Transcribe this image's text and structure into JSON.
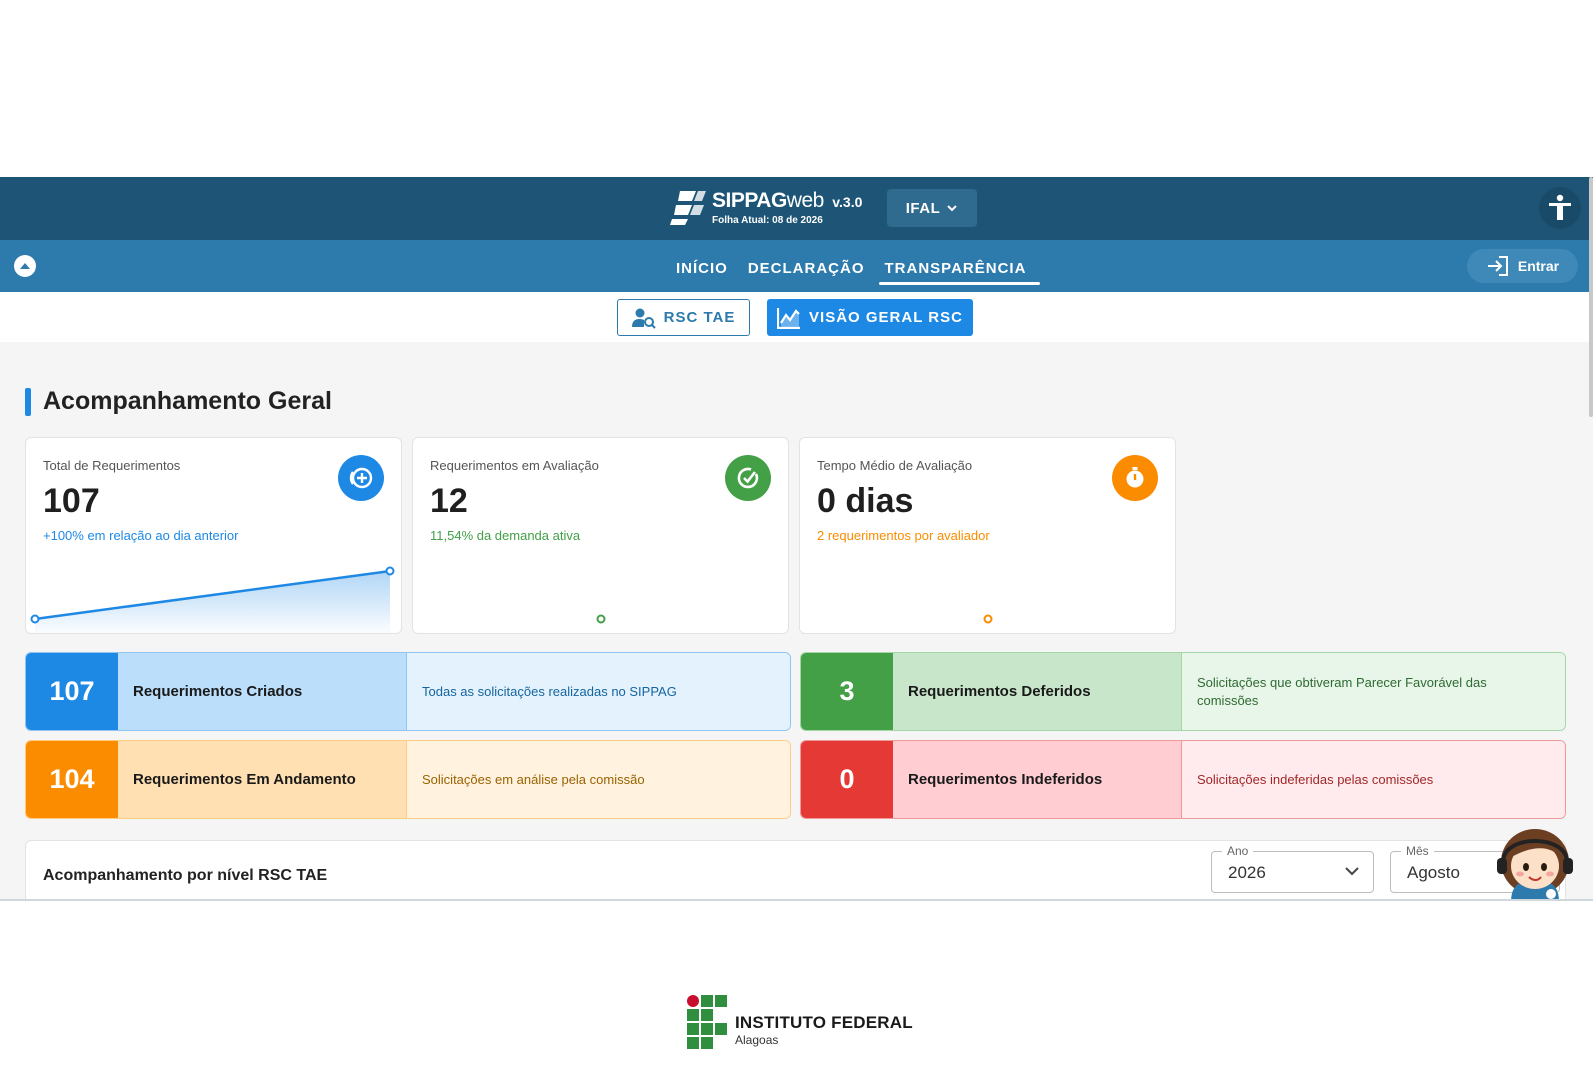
{
  "header": {
    "brand_name_bold": "SIPPAG",
    "brand_name_light": "web",
    "version": "v.3.0",
    "subtitle": "Folha Atual: 08 de 2026",
    "org_selector": "IFAL"
  },
  "nav": {
    "items": [
      {
        "label": "INÍCIO"
      },
      {
        "label": "DECLARAÇÃO"
      },
      {
        "label": "TRANSPARÊNCIA"
      }
    ],
    "active": "TRANSPARÊNCIA",
    "login_label": "Entrar"
  },
  "subnav": {
    "btn1": "RSC TAE",
    "btn2": "VISÃO GERAL RSC"
  },
  "section_title": "Acompanhamento Geral",
  "kpis": [
    {
      "label": "Total de Requerimentos",
      "value": "107",
      "note": "+100% em relação ao dia anterior",
      "color": "#1e88e5"
    },
    {
      "label": "Requerimentos em Avaliação",
      "value": "12",
      "note": "11,54% da demanda ativa",
      "color": "#43a047"
    },
    {
      "label": "Tempo Médio de Avaliação",
      "value": "0 dias",
      "note": "2 requerimentos por avaliador",
      "color": "#fb8c00"
    }
  ],
  "stats": [
    {
      "num": "107",
      "title": "Requerimentos Criados",
      "desc": "Todas as solicitações realizadas no SIPPAG"
    },
    {
      "num": "3",
      "title": "Requerimentos Deferidos",
      "desc": "Solicitações que obtiveram Parecer Favorável das comissões"
    },
    {
      "num": "104",
      "title": "Requerimentos Em Andamento",
      "desc": "Solicitações em análise pela comissão"
    },
    {
      "num": "0",
      "title": "Requerimentos Indeferidos",
      "desc": "Solicitações indeferidas pelas comissões"
    }
  ],
  "level_card": {
    "title": "Acompanhamento por nível RSC TAE",
    "year_label": "Ano",
    "year_value": "2026",
    "month_label": "Mês",
    "month_value": "Agosto"
  },
  "footer": {
    "institution": "INSTITUTO FEDERAL",
    "campus": "Alagoas"
  },
  "icons": {
    "brand": "sippag-logo-icon",
    "accessibility": "accessibility-icon",
    "nav_toggle": "chevron-up-icon",
    "login": "login-icon",
    "rsc_tae": "person-search-icon",
    "overview": "line-chart-icon",
    "kpi1": "add-circle-icon",
    "kpi2": "check-circle-icon",
    "kpi3": "timer-icon"
  }
}
